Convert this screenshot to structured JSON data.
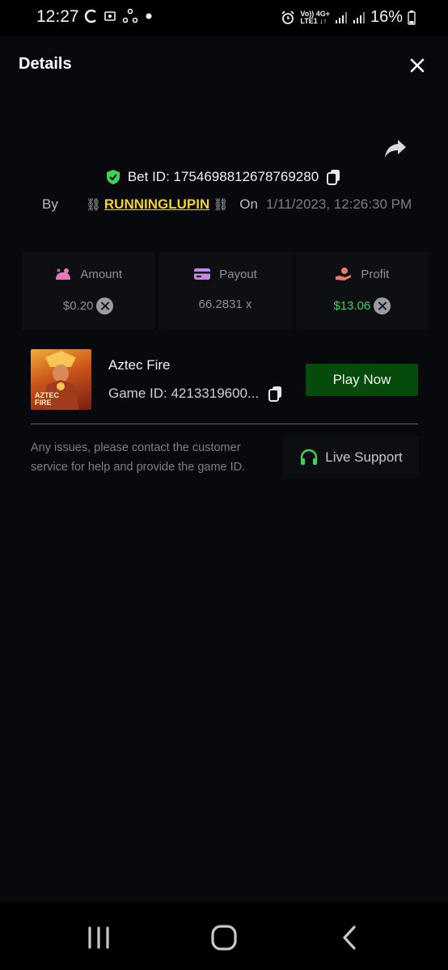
{
  "status_bar": {
    "time": "12:27",
    "battery": "16%",
    "network_top": "Vo)) 4G+",
    "network_bottom": "LTE1 ↓↑"
  },
  "header": {
    "title": "Details"
  },
  "bet": {
    "label": "Bet ID: 1754698812678769280",
    "by_label": "By",
    "username": "RUNNINGLUPIN",
    "chain_left": "⛓",
    "chain_right": "⛓",
    "on_label": "On",
    "date": "1/11/2023, 12:26:30 PM"
  },
  "stats": {
    "amount": {
      "label": "Amount",
      "value": "$0.20"
    },
    "payout": {
      "label": "Payout",
      "value": "66.2831 x"
    },
    "profit": {
      "label": "Profit",
      "value": "$13.06"
    }
  },
  "game": {
    "name": "Aztec Fire",
    "thumb_text_1": "AZTEC",
    "thumb_text_2": "FIRE",
    "game_id": "Game ID: 4213319600...",
    "play_label": "Play Now"
  },
  "support": {
    "text": "Any issues, please contact the customer service for help and provide the game ID.",
    "button_label": "Live Support"
  },
  "colors": {
    "profit": "#3fd15a",
    "username": "#f3d22e",
    "play_bg": "#064a0c",
    "shield": "#3fd15a",
    "support_icon": "#3fd15a"
  }
}
